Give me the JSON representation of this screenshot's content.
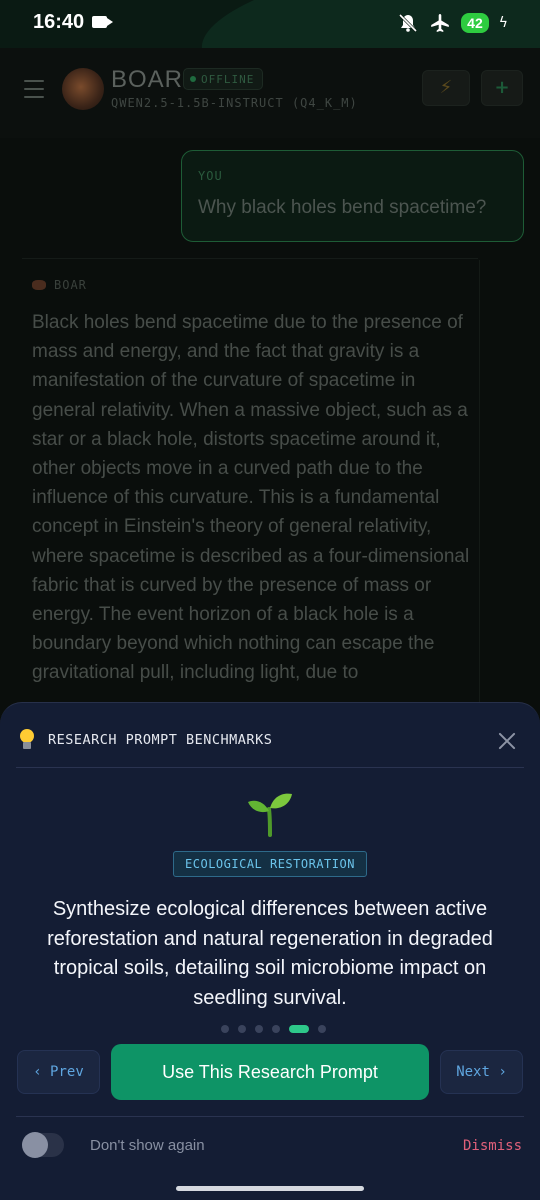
{
  "status_bar": {
    "time": "16:40",
    "battery": "42",
    "icons": [
      "video-recording-icon",
      "mute-icon",
      "airplane-mode-icon",
      "battery-icon",
      "charging-icon"
    ]
  },
  "header": {
    "app_title": "BOAR",
    "status": "OFFLINE",
    "model": "QWEN2.5-1.5B-INSTRUCT (Q4_K_M)"
  },
  "chat": {
    "user_label": "YOU",
    "user_message": "Why black holes bend spacetime?",
    "bot_label": "BOAR",
    "bot_message": "Black holes bend spacetime due to the presence of mass and energy, and the fact that gravity is a manifestation of the curvature of spacetime in general relativity. When a massive object, such as a star or a black hole, distorts spacetime around it, other objects move in a curved path due to the influence of this curvature. This is a fundamental concept in Einstein's theory of general relativity, where spacetime is described as a four-dimensional fabric that is curved by the presence of mass or energy. The event horizon of a black hole is a boundary beyond which nothing can escape the gravitational pull, including light, due to"
  },
  "sheet": {
    "title": "RESEARCH PROMPT BENCHMARKS",
    "category": "ECOLOGICAL RESTORATION",
    "prompt": "Synthesize ecological differences between active reforestation and natural regeneration in degraded tropical soils, detailing soil microbiome impact on seedling survival.",
    "pagination": {
      "total": 6,
      "active_index": 4
    },
    "prev_label": "‹ Prev",
    "use_label": "Use This Research Prompt",
    "next_label": "Next ›",
    "dont_show_label": "Don't show again",
    "dont_show_checked": false,
    "dismiss_label": "Dismiss"
  },
  "colors": {
    "accent_green": "#0e9466",
    "sheet_bg": "#141d34",
    "tag_blue": "#6bc3ea",
    "dismiss_red": "#e0607a"
  }
}
